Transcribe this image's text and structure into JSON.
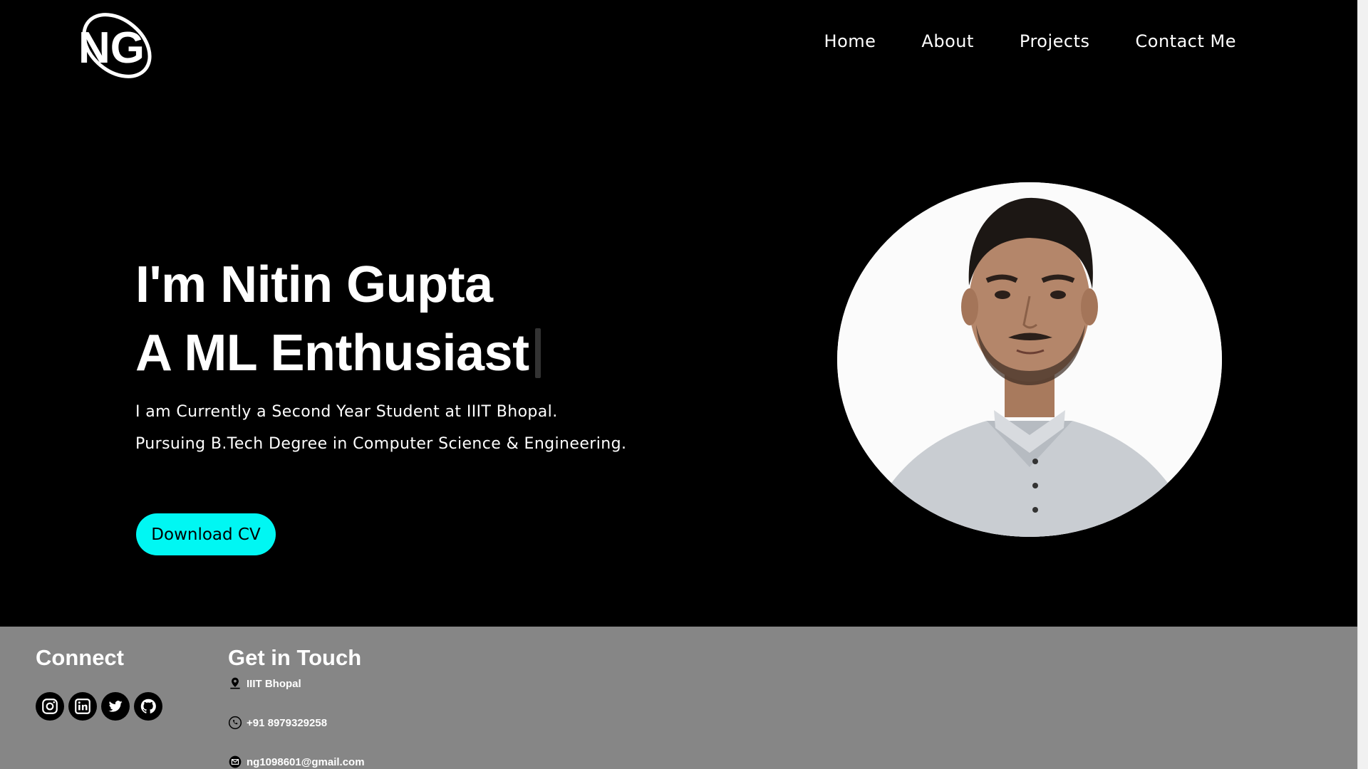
{
  "header": {
    "logo_alt": "NG",
    "nav": [
      "Home",
      "About",
      "Projects",
      "Contact Me"
    ]
  },
  "hero": {
    "name_line": "I'm Nitin Gupta",
    "role_line": "A ML Enthusiast",
    "desc_1": "I am Currently a Second Year Student at IIIT Bhopal.",
    "desc_2": "Pursuing B.Tech Degree in Computer Science & Engineering.",
    "cta": "Download CV"
  },
  "footer": {
    "connect_title": "Connect",
    "touch_title": "Get in Touch",
    "socials": [
      "instagram-icon",
      "linkedin-icon",
      "twitter-icon",
      "github-icon"
    ],
    "location": "IIIT Bhopal",
    "phone": "+91 8979329258",
    "email": "ng1098601@gmail.com"
  },
  "colors": {
    "background": "#000000",
    "accent": "#00f7f3",
    "footer_bg": "#868686"
  }
}
